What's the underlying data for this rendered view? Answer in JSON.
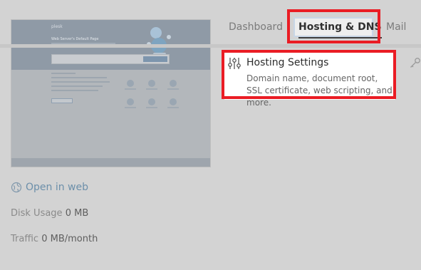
{
  "left": {
    "preview": {
      "brand_text": "plesk",
      "heading_text": "Web Server's Default Page"
    },
    "open_in_web_label": "Open in web",
    "disk_usage": {
      "label": "Disk Usage",
      "value": "0 MB"
    },
    "traffic": {
      "label": "Traffic",
      "value": "0 MB/month"
    }
  },
  "tabs": [
    {
      "label": "Dashboard",
      "active": false
    },
    {
      "label": "Hosting & DNS",
      "active": true
    },
    {
      "label": "Mail",
      "active": false
    }
  ],
  "hosting_settings": {
    "title": "Hosting Settings",
    "description": "Domain name, document root, SSL certificate, web scripting, and more.",
    "icon": "sliders-icon"
  },
  "icons": {
    "globe": "globe-icon",
    "tool": "key-icon"
  },
  "colors": {
    "highlight_red": "#ea1c24",
    "link_blue": "#6c8faa",
    "background": "#d3d3d3"
  }
}
